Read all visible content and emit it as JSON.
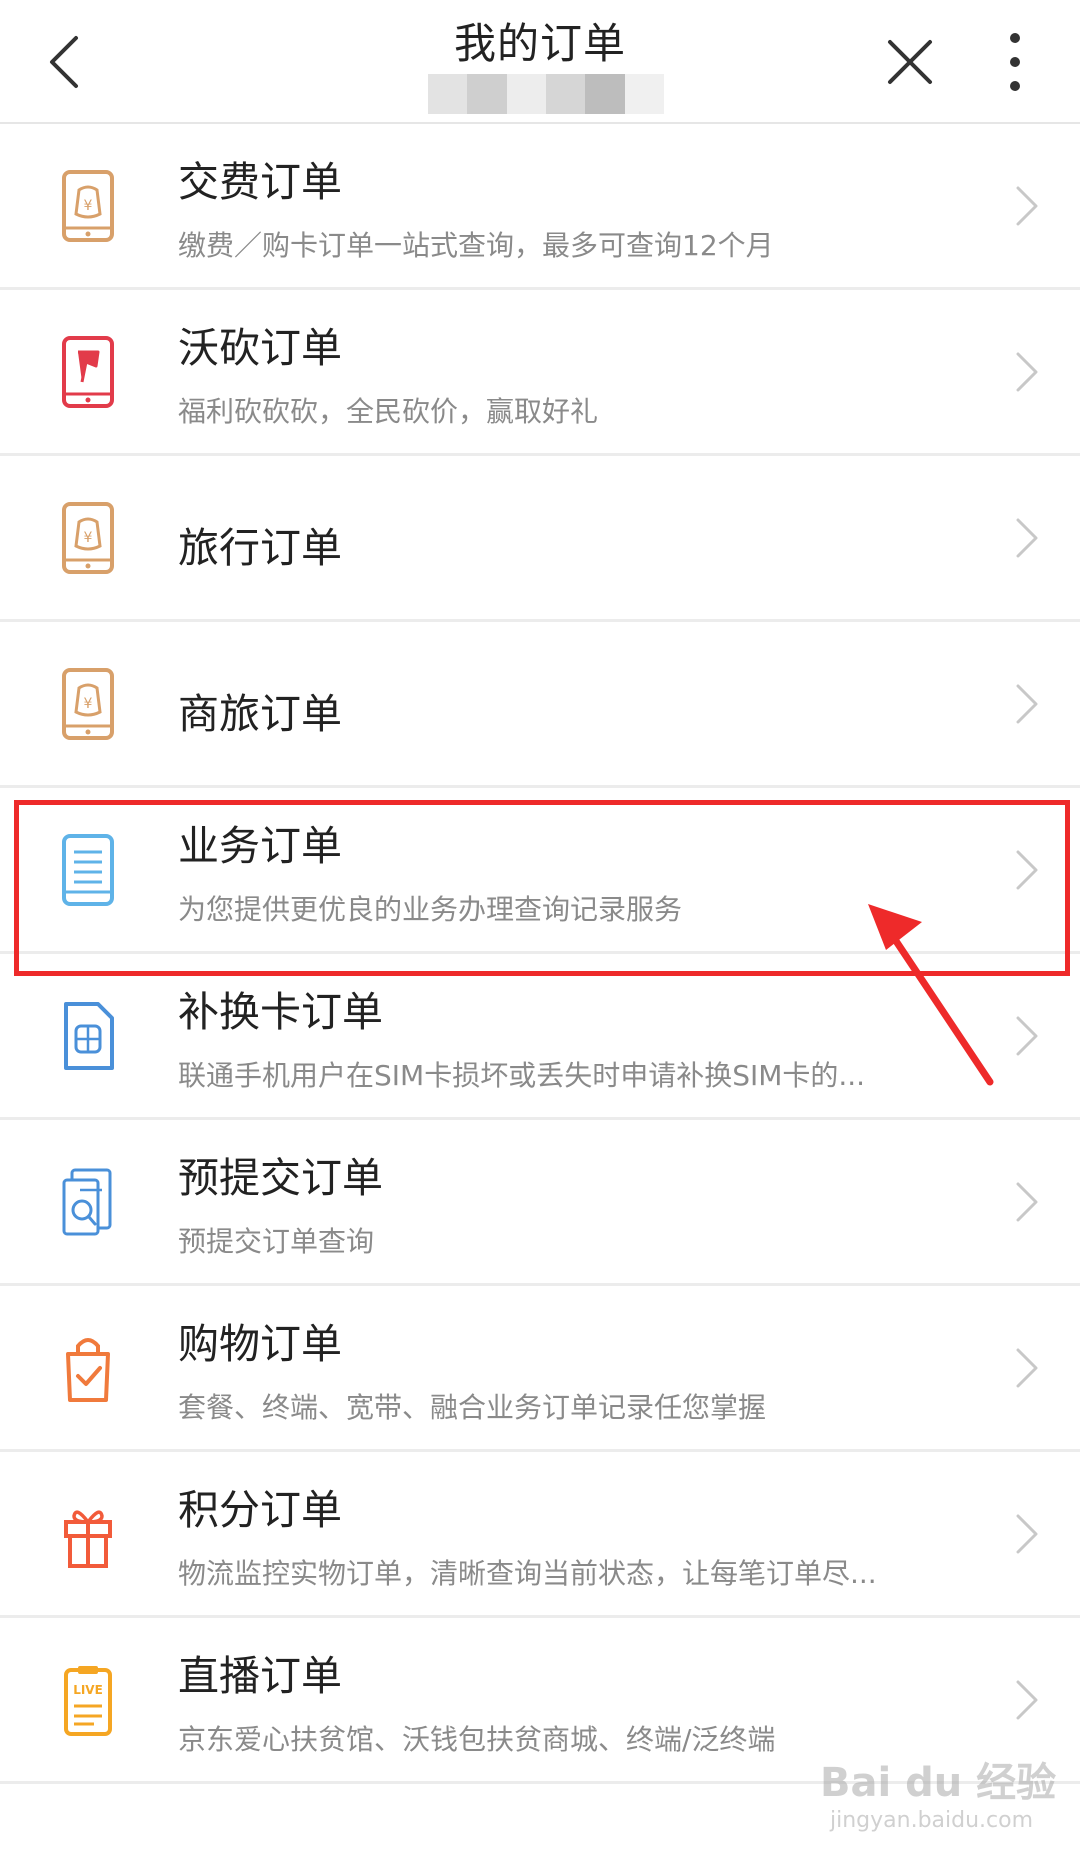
{
  "header": {
    "title": "我的订单",
    "back_icon": "chevron-left-icon",
    "close_icon": "close-icon",
    "more_icon": "more-vertical-icon",
    "subtitle_redacted_colors": [
      "#e3e3e3",
      "#cfcfcf",
      "#ededed",
      "#d6d6d6",
      "#bdbdbd",
      "#f0f0f0"
    ]
  },
  "orders": [
    {
      "title": "交费订单",
      "desc": "缴费／购卡订单一站式查询，最多可查询12个月",
      "icon": "money-phone-icon",
      "icon_color": "#d8a06a"
    },
    {
      "title": "沃砍订单",
      "desc": "福利砍砍砍，全民砍价，赢取好礼",
      "icon": "axe-phone-icon",
      "icon_color": "#e23b4a"
    },
    {
      "title": "旅行订单",
      "desc": "",
      "icon": "money-phone-icon",
      "icon_color": "#d8a06a"
    },
    {
      "title": "商旅订单",
      "desc": "",
      "icon": "money-phone-icon",
      "icon_color": "#d8a06a"
    },
    {
      "title": "业务订单",
      "desc": "为您提供更优良的业务办理查询记录服务",
      "icon": "document-phone-icon",
      "icon_color": "#5fb3e8"
    },
    {
      "title": "补换卡订单",
      "desc": "联通手机用户在SIM卡损坏或丢失时申请补换SIM卡的...",
      "icon": "sim-card-icon",
      "icon_color": "#4a90d9"
    },
    {
      "title": "预提交订单",
      "desc": "预提交订单查询",
      "icon": "document-search-icon",
      "icon_color": "#4a90d9"
    },
    {
      "title": "购物订单",
      "desc": "套餐、终端、宽带、融合业务订单记录任您掌握",
      "icon": "shopping-bag-icon",
      "icon_color": "#f07a3c"
    },
    {
      "title": "积分订单",
      "desc": "物流监控实物订单，清晰查询当前状态，让每笔订单尽...",
      "icon": "gift-icon",
      "icon_color": "#f25b3a"
    },
    {
      "title": "直播订单",
      "desc": "京东爱心扶贫馆、沃钱包扶贫商城、终端/泛终端",
      "icon": "live-clipboard-icon",
      "icon_color": "#f5a623"
    }
  ],
  "highlight": {
    "target": "业务订单",
    "color": "#ee2a2a"
  },
  "watermark": {
    "text": "Bai du 经验",
    "sub": "jingyan.baidu.com"
  }
}
